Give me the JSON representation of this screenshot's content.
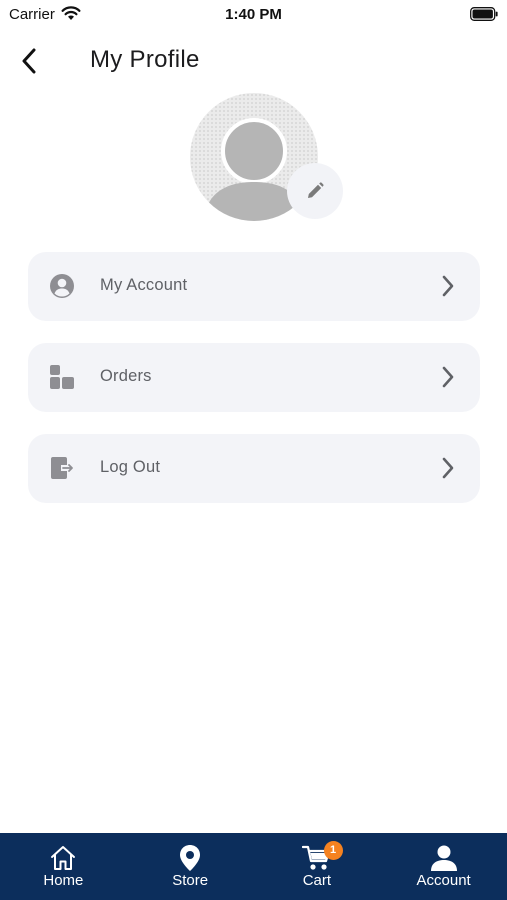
{
  "status_bar": {
    "carrier": "Carrier",
    "time": "1:40 PM"
  },
  "header": {
    "title": "My Profile",
    "back_icon": "chevron-left-icon"
  },
  "avatar": {
    "edit_icon": "pencil-icon"
  },
  "menu": [
    {
      "label": "My Account",
      "icon": "user-circle-icon"
    },
    {
      "label": "Orders",
      "icon": "boxes-icon"
    },
    {
      "label": "Log Out",
      "icon": "logout-icon"
    }
  ],
  "tab_bar": {
    "background": "#0c2e5c",
    "tabs": [
      {
        "label": "Home",
        "icon": "home-icon"
      },
      {
        "label": "Store",
        "icon": "location-pin-icon"
      },
      {
        "label": "Cart",
        "icon": "cart-icon",
        "badge": "1"
      },
      {
        "label": "Account",
        "icon": "user-icon"
      }
    ]
  },
  "colors": {
    "badge": "#f58220",
    "menu_bg": "#f3f4f8",
    "icon_gray": "#8e8e93"
  }
}
